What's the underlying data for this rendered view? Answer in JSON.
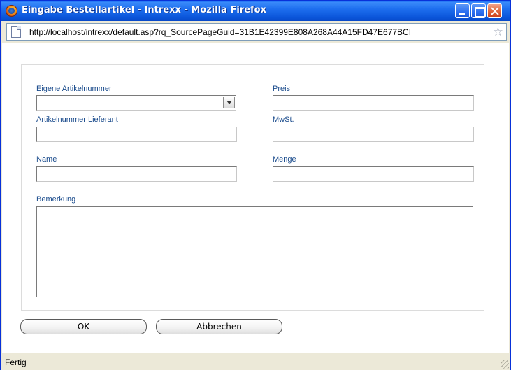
{
  "window": {
    "title": "Eingabe Bestellartikel - Intrexx - Mozilla Firefox",
    "icon": "firefox-icon",
    "controls": [
      "minimize-icon",
      "maximize-icon",
      "close-icon"
    ]
  },
  "urlbar": {
    "url": "http://localhost/intrexx/default.asp?rq_SourcePageGuid=31B1E42399E808A268A44A15FD47E677BCI",
    "page_icon": "page-icon",
    "bookmark_icon": "star-icon"
  },
  "form": {
    "fields": {
      "eigene_artikelnummer": {
        "label": "Eigene Artikelnummer",
        "value": ""
      },
      "preis": {
        "label": "Preis",
        "value": ""
      },
      "artikelnummer_lieferant": {
        "label": "Artikelnummer Lieferant",
        "value": ""
      },
      "mwst": {
        "label": "MwSt.",
        "value": ""
      },
      "name": {
        "label": "Name",
        "value": ""
      },
      "menge": {
        "label": "Menge",
        "value": ""
      },
      "bemerkung": {
        "label": "Bemerkung",
        "value": ""
      }
    },
    "buttons": {
      "ok": "OK",
      "cancel": "Abbrechen"
    }
  },
  "status": {
    "text": "Fertig"
  },
  "colors": {
    "titlebar": "#0a54d8",
    "label": "#1a4b8c",
    "chrome": "#ece9d8"
  }
}
